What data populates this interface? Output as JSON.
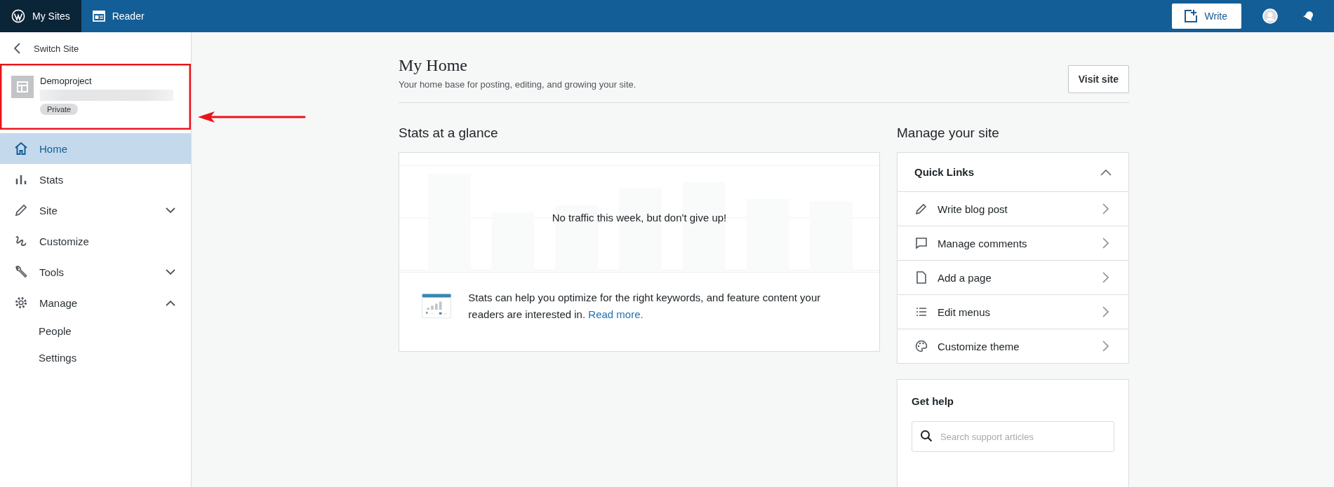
{
  "top_bar": {
    "tabs": [
      {
        "label": "My Sites",
        "selected": true
      },
      {
        "label": "Reader",
        "selected": false
      }
    ],
    "write_button": "Write"
  },
  "sidebar": {
    "back_link": "Switch Site",
    "site": {
      "name": "Demoproject",
      "badge": "Private"
    },
    "items": [
      {
        "label": "Home",
        "selected": true
      },
      {
        "label": "Stats",
        "selected": false
      },
      {
        "label": "Site",
        "selected": false,
        "expanded": false
      },
      {
        "label": "Customize",
        "selected": false
      },
      {
        "label": "Tools",
        "selected": false,
        "expanded": false
      },
      {
        "label": "Manage",
        "selected": false,
        "expanded": true,
        "children": [
          {
            "label": "People"
          },
          {
            "label": "Settings"
          }
        ]
      }
    ]
  },
  "header": {
    "title": "My Home",
    "subtitle": "Your home base for posting, editing, and growing your site.",
    "button": "Visit site"
  },
  "stats": {
    "title": "Stats at a glance",
    "empty_message": "No traffic this week, but don't give up!",
    "tip": "Stats can help you optimize for the right keywords, and feature content your readers are interested in.",
    "link": "Read more."
  },
  "manage": {
    "title": "Manage your site",
    "quick_links": {
      "title": "Quick Links",
      "expanded": true,
      "items": [
        {
          "label": "Write blog post"
        },
        {
          "label": "Manage comments"
        },
        {
          "label": "Add a page"
        },
        {
          "label": "Edit menus"
        },
        {
          "label": "Customize theme"
        }
      ]
    },
    "help": {
      "title": "Get help",
      "search": {
        "placeholder": "Search support articles"
      }
    }
  }
}
